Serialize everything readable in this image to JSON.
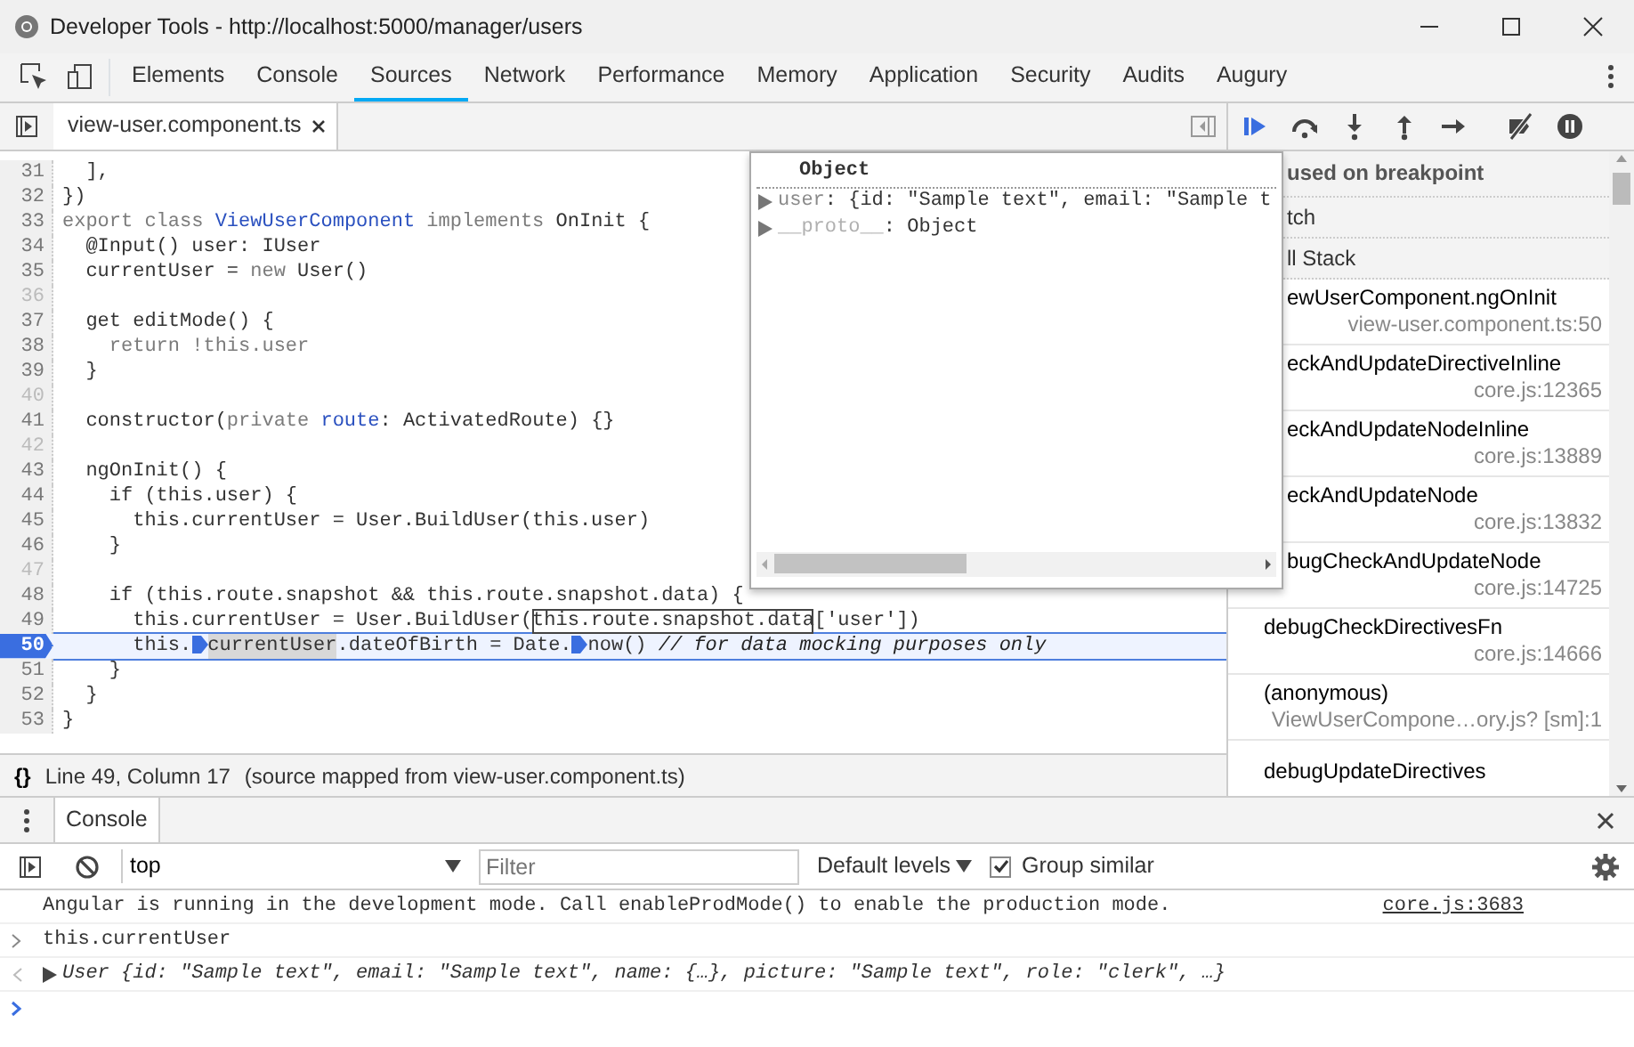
{
  "window": {
    "title": "Developer Tools - http://localhost:5000/manager/users"
  },
  "panel_tabs": [
    {
      "label": "Elements",
      "selected": false
    },
    {
      "label": "Console",
      "selected": false
    },
    {
      "label": "Sources",
      "selected": true
    },
    {
      "label": "Network",
      "selected": false
    },
    {
      "label": "Performance",
      "selected": false
    },
    {
      "label": "Memory",
      "selected": false
    },
    {
      "label": "Application",
      "selected": false
    },
    {
      "label": "Security",
      "selected": false
    },
    {
      "label": "Audits",
      "selected": false
    },
    {
      "label": "Augury",
      "selected": false
    }
  ],
  "editor": {
    "file_tabs": [
      {
        "label": "view-user.component.ts",
        "selected": true
      }
    ],
    "debug_buttons": [
      {
        "kind": "resume"
      },
      {
        "kind": "step-over"
      },
      {
        "kind": "step-into"
      },
      {
        "kind": "step-out"
      },
      {
        "kind": "step"
      },
      {
        "kind": "deactivate"
      },
      {
        "kind": "pause"
      }
    ],
    "lines": [
      {
        "number": "31",
        "current": false,
        "tokens": [
          {
            "kind": "plain",
            "text": "  ],"
          }
        ]
      },
      {
        "number": "32",
        "current": false,
        "tokens": [
          {
            "kind": "plain",
            "text": "})"
          }
        ]
      },
      {
        "number": "33",
        "current": false,
        "tokens": [
          {
            "kind": "keyword",
            "text": "export class "
          },
          {
            "kind": "name",
            "text": "ViewUserComponent"
          },
          {
            "kind": "keyword",
            "text": " implements "
          },
          {
            "kind": "plain",
            "text": "OnInit {"
          }
        ]
      },
      {
        "number": "34",
        "current": false,
        "tokens": [
          {
            "kind": "plain",
            "text": "  @Input() user: IUser"
          }
        ]
      },
      {
        "number": "35",
        "current": false,
        "tokens": [
          {
            "kind": "plain",
            "text": "  currentUser = "
          },
          {
            "kind": "keyword",
            "text": "new"
          },
          {
            "kind": "plain",
            "text": " User()"
          }
        ]
      },
      {
        "number": "36",
        "current": false
      },
      {
        "number": "37",
        "current": false,
        "tokens": [
          {
            "kind": "plain",
            "text": "  get editMode() {"
          }
        ]
      },
      {
        "number": "38",
        "current": false,
        "tokens": [
          {
            "kind": "keyword",
            "text": "    return !this.user"
          }
        ]
      },
      {
        "number": "39",
        "current": false,
        "tokens": [
          {
            "kind": "plain",
            "text": "  }"
          }
        ]
      },
      {
        "number": "40",
        "current": false
      },
      {
        "number": "41",
        "current": false,
        "tokens": [
          {
            "kind": "plain",
            "text": "  constructor("
          },
          {
            "kind": "keyword",
            "text": "private "
          },
          {
            "kind": "name",
            "text": "route"
          },
          {
            "kind": "plain",
            "text": ": ActivatedRoute) {}"
          }
        ]
      },
      {
        "number": "42",
        "current": false
      },
      {
        "number": "43",
        "current": false,
        "tokens": [
          {
            "kind": "plain",
            "text": "  ngOnInit() {"
          }
        ]
      },
      {
        "number": "44",
        "current": false,
        "tokens": [
          {
            "kind": "plain",
            "text": "    if (this.user) {"
          }
        ]
      },
      {
        "number": "45",
        "current": false,
        "tokens": [
          {
            "kind": "plain",
            "text": "      this.currentUser = User.BuildUser(this.user)"
          }
        ]
      },
      {
        "number": "46",
        "current": false,
        "tokens": [
          {
            "kind": "plain",
            "text": "    }"
          }
        ]
      },
      {
        "number": "47",
        "current": false
      },
      {
        "number": "48",
        "current": false,
        "tokens": [
          {
            "kind": "plain",
            "text": "    if (this.route.snapshot && this.route.snapshot.data) {"
          }
        ]
      },
      {
        "number": "49",
        "current": false,
        "tokens": [
          {
            "kind": "plain",
            "text": "      this.currentUser = User.BuildUser("
          },
          {
            "kind": "boxed",
            "text": "this.route.snapshot.data"
          },
          {
            "kind": "plain",
            "text": "['user'])"
          }
        ]
      },
      {
        "number": "50",
        "current": true,
        "tokens": [
          {
            "kind": "plain",
            "text": "      this."
          },
          {
            "kind": "marker"
          },
          {
            "kind": "hilite",
            "text": "currentUser"
          },
          {
            "kind": "plain",
            "text": ".dateOfBirth = Date."
          },
          {
            "kind": "marker"
          },
          {
            "kind": "plain",
            "text": "now() "
          },
          {
            "kind": "comment",
            "text": "// for data mocking purposes only"
          }
        ]
      },
      {
        "number": "51",
        "current": false,
        "tokens": [
          {
            "kind": "plain",
            "text": "    }"
          }
        ]
      },
      {
        "number": "52",
        "current": false,
        "tokens": [
          {
            "kind": "plain",
            "text": "  }"
          }
        ]
      },
      {
        "number": "53",
        "current": false,
        "tokens": [
          {
            "kind": "plain",
            "text": "}"
          }
        ]
      }
    ],
    "status": {
      "pretty_print": "{}",
      "position": "Line 49, Column 17",
      "source_map": "(source mapped from view-user.component.ts)"
    }
  },
  "popover": {
    "title": "Object",
    "rows": [
      {
        "key": "user",
        "key_dim": false,
        "value": ": {id: \"Sample text\", email: \"Sample t"
      },
      {
        "key": "__proto__",
        "key_dim": true,
        "value": ": Object"
      }
    ]
  },
  "debugger": {
    "sections": [
      {
        "label": "used on breakpoint",
        "kind": "paused"
      },
      {
        "label": "tch",
        "kind": "header"
      },
      {
        "label": "ll Stack",
        "kind": "header"
      }
    ],
    "call_stack": [
      {
        "function": "ewUserComponent.ngOnInit",
        "location": "view-user.component.ts:50",
        "under_popover": true
      },
      {
        "function": "eckAndUpdateDirectiveInline",
        "location": "core.js:12365",
        "under_popover": true
      },
      {
        "function": "eckAndUpdateNodeInline",
        "location": "core.js:13889",
        "under_popover": true
      },
      {
        "function": "eckAndUpdateNode",
        "location": "core.js:13832",
        "under_popover": true
      },
      {
        "function": "bugCheckAndUpdateNode",
        "location": "core.js:14725",
        "under_popover": true
      },
      {
        "function": "debugCheckDirectivesFn",
        "location": "core.js:14666",
        "under_popover": false
      },
      {
        "function": "(anonymous)",
        "location": "ViewUserCompone…ory.js? [sm]:1",
        "under_popover": false
      },
      {
        "function": "debugUpdateDirectives",
        "under_popover": false
      }
    ]
  },
  "drawer": {
    "tabs": [
      {
        "label": "Console",
        "selected": true
      }
    ],
    "context": "top",
    "filter": {
      "placeholder": "Filter"
    },
    "levels": "Default levels",
    "group_similar": {
      "label": "Group similar",
      "checked": true
    },
    "messages": [
      {
        "kind": "log",
        "text": "Angular is running in the development mode. Call enableProdMode() to enable the production mode.",
        "source": "core.js:3683"
      },
      {
        "kind": "input",
        "text": "this.currentUser"
      },
      {
        "kind": "result",
        "text": "User {id: \"Sample text\", email: \"Sample text\", name: {…}, picture: \"Sample text\", role: \"clerk\", …}"
      },
      {
        "kind": "prompt"
      }
    ]
  }
}
